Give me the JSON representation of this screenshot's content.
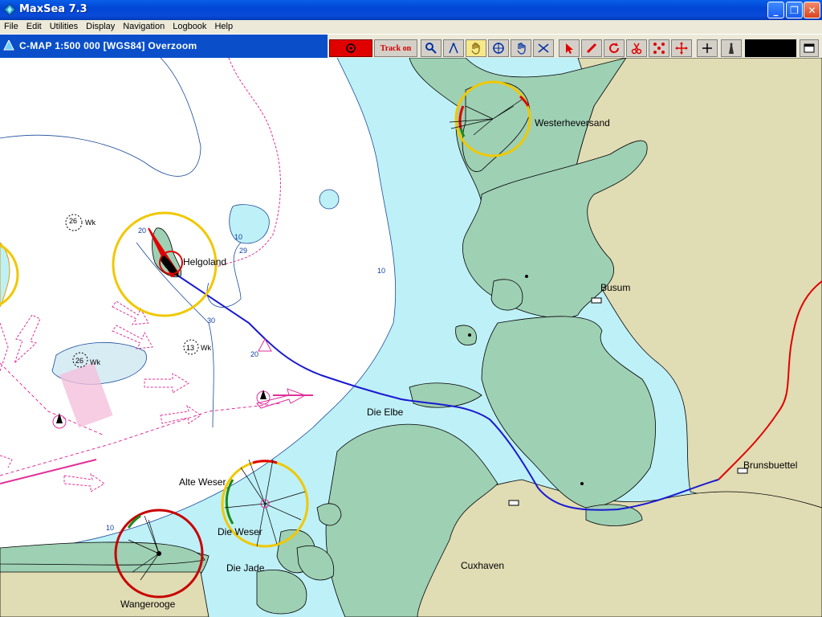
{
  "window": {
    "title": "MaxSea 7.3"
  },
  "menu": [
    "File",
    "Edit",
    "Utilities",
    "Display",
    "Navigation",
    "Logbook",
    "Help"
  ],
  "chart_header": {
    "title": "C-MAP  1:500 000 [WGS84]    Overzoom"
  },
  "toolbar": {
    "track_label": "Track on"
  },
  "places": {
    "helgoland": "Helgoland",
    "westerheversand": "Westerheversand",
    "busum": "Busum",
    "die_elbe": "Die Elbe",
    "brunsbuettel": "Brunsbuettel",
    "alte_weser": "Alte Weser",
    "die_weser": "Die Weser",
    "die_jade": "Die Jade",
    "cuxhaven": "Cuxhaven",
    "wangerooge": "Wangerooge"
  },
  "depths": [
    "20",
    "10",
    "29",
    "10",
    "30",
    "20",
    "10",
    "26",
    "13",
    "26"
  ],
  "depth_units": [
    "Wk",
    "Wk",
    "Wk"
  ],
  "colors": {
    "land": "#9ed0b4",
    "mainland": "#e0dcb4",
    "shallow": "#bef0f7",
    "deep": "#ffffff",
    "track": "#1a1ad0",
    "route": "#e00000",
    "light_sector": "#f0c800"
  }
}
